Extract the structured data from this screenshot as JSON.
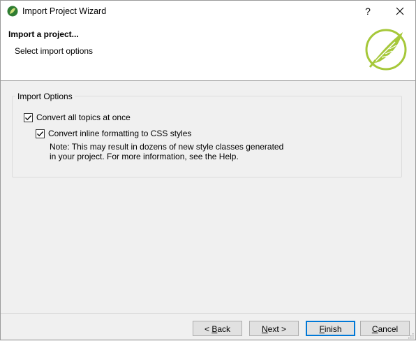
{
  "window": {
    "title": "Import Project Wizard",
    "help_label": "?"
  },
  "header": {
    "title": "Import a project...",
    "subtitle": "Select import options"
  },
  "options": {
    "group_label": "Import Options",
    "convert_all": {
      "label": "Convert all topics at once",
      "checked": true
    },
    "convert_inline": {
      "label": "Convert inline formatting to CSS styles",
      "checked": true
    },
    "note": "Note: This may result in dozens of new style classes generated in your project. For more information, see the Help."
  },
  "buttons": {
    "back": {
      "prefix": "< ",
      "mnemonic": "B",
      "rest": "ack"
    },
    "next": {
      "prefix": "",
      "mnemonic": "N",
      "rest": "ext >"
    },
    "finish": {
      "prefix": "",
      "mnemonic": "F",
      "rest": "inish"
    },
    "cancel": {
      "prefix": "",
      "mnemonic": "C",
      "rest": "ancel"
    }
  },
  "colors": {
    "accent": "#a6c83a",
    "default_button_border": "#0078d7"
  }
}
